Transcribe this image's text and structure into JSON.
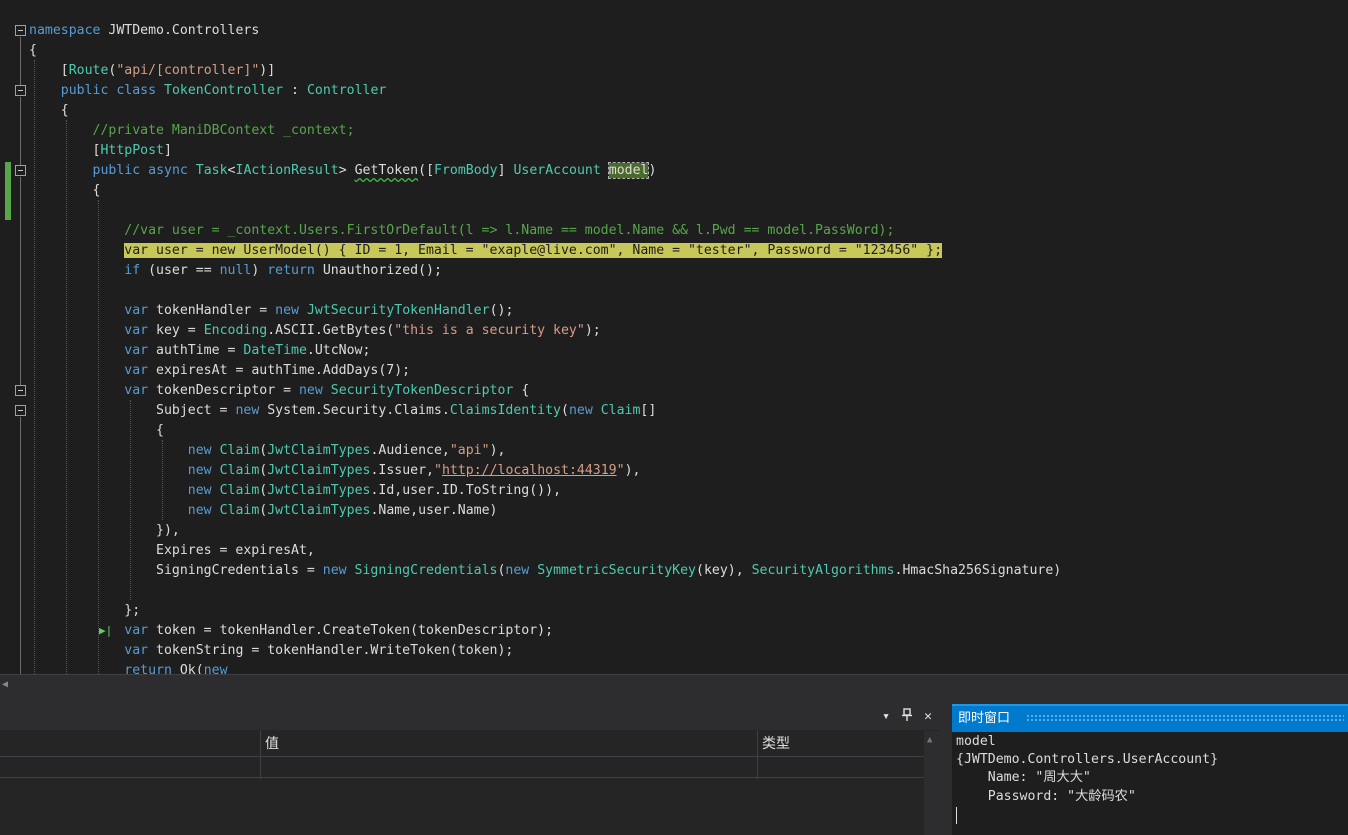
{
  "editor": {
    "lines": [
      [
        [
          "kw",
          "namespace"
        ],
        [
          "p",
          " JWTDemo.Controllers"
        ]
      ],
      [
        [
          "p",
          "{"
        ]
      ],
      [
        [
          "p",
          "    ["
        ],
        [
          "ty",
          "Route"
        ],
        [
          "p",
          "("
        ],
        [
          "st",
          "\"api/[controller]\""
        ],
        [
          "p",
          ")]"
        ]
      ],
      [
        [
          "p",
          "    "
        ],
        [
          "kw",
          "public"
        ],
        [
          "p",
          " "
        ],
        [
          "kw",
          "class"
        ],
        [
          "p",
          " "
        ],
        [
          "ty",
          "TokenController"
        ],
        [
          "p",
          " : "
        ],
        [
          "ty",
          "Controller"
        ]
      ],
      [
        [
          "p",
          "    {"
        ]
      ],
      [
        [
          "p",
          "        "
        ],
        [
          "cm",
          "//private ManiDBContext _context;"
        ]
      ],
      [
        [
          "p",
          "        ["
        ],
        [
          "ty",
          "HttpPost"
        ],
        [
          "p",
          "]"
        ]
      ],
      [
        [
          "p",
          "        "
        ],
        [
          "kw",
          "public"
        ],
        [
          "p",
          " "
        ],
        [
          "kw",
          "async"
        ],
        [
          "p",
          " "
        ],
        [
          "ty",
          "Task"
        ],
        [
          "p",
          "<"
        ],
        [
          "ty",
          "IActionResult"
        ],
        [
          "p",
          "> "
        ],
        [
          "sq",
          "GetToken"
        ],
        [
          "p",
          "(["
        ],
        [
          "ty",
          "FromBody"
        ],
        [
          "p",
          "] "
        ],
        [
          "ty",
          "UserAccount"
        ],
        [
          "p",
          " "
        ],
        [
          "sel",
          "model"
        ],
        [
          "p",
          ")"
        ]
      ],
      [
        [
          "p",
          "        {"
        ]
      ],
      [
        [
          "p",
          ""
        ]
      ],
      [
        [
          "p",
          "            "
        ],
        [
          "cm",
          "//var user = _context.Users.FirstOrDefault(l => l.Name == model.Name && l.Pwd == model.PassWord);"
        ]
      ],
      [
        [
          "p",
          "            "
        ],
        [
          "hl",
          "var user = new UserModel() { ID = 1, Email = \"exaple@live.com\", Name = \"tester\", Password = \"123456\" };"
        ]
      ],
      [
        [
          "p",
          "            "
        ],
        [
          "kw",
          "if"
        ],
        [
          "p",
          " (user == "
        ],
        [
          "kw",
          "null"
        ],
        [
          "p",
          ") "
        ],
        [
          "kw",
          "return"
        ],
        [
          "p",
          " Unauthorized();"
        ]
      ],
      [
        [
          "p",
          ""
        ]
      ],
      [
        [
          "p",
          "            "
        ],
        [
          "kw",
          "var"
        ],
        [
          "p",
          " tokenHandler = "
        ],
        [
          "kw",
          "new"
        ],
        [
          "p",
          " "
        ],
        [
          "ty",
          "JwtSecurityTokenHandler"
        ],
        [
          "p",
          "();"
        ]
      ],
      [
        [
          "p",
          "            "
        ],
        [
          "kw",
          "var"
        ],
        [
          "p",
          " key = "
        ],
        [
          "ty",
          "Encoding"
        ],
        [
          "p",
          ".ASCII.GetBytes("
        ],
        [
          "st",
          "\"this is a security key\""
        ],
        [
          "p",
          ");"
        ]
      ],
      [
        [
          "p",
          "            "
        ],
        [
          "kw",
          "var"
        ],
        [
          "p",
          " authTime = "
        ],
        [
          "ty",
          "DateTime"
        ],
        [
          "p",
          ".UtcNow;"
        ]
      ],
      [
        [
          "p",
          "            "
        ],
        [
          "kw",
          "var"
        ],
        [
          "p",
          " expiresAt = authTime.AddDays(7);"
        ]
      ],
      [
        [
          "p",
          "            "
        ],
        [
          "kw",
          "var"
        ],
        [
          "p",
          " tokenDescriptor = "
        ],
        [
          "kw",
          "new"
        ],
        [
          "p",
          " "
        ],
        [
          "ty",
          "SecurityTokenDescriptor"
        ],
        [
          "p",
          " {"
        ]
      ],
      [
        [
          "p",
          "                Subject = "
        ],
        [
          "kw",
          "new"
        ],
        [
          "p",
          " System.Security.Claims."
        ],
        [
          "ty",
          "ClaimsIdentity"
        ],
        [
          "p",
          "("
        ],
        [
          "kw",
          "new"
        ],
        [
          "p",
          " "
        ],
        [
          "ty",
          "Claim"
        ],
        [
          "p",
          "[]"
        ]
      ],
      [
        [
          "p",
          "                {"
        ]
      ],
      [
        [
          "p",
          "                    "
        ],
        [
          "kw",
          "new"
        ],
        [
          "p",
          " "
        ],
        [
          "ty",
          "Claim"
        ],
        [
          "p",
          "("
        ],
        [
          "ty",
          "JwtClaimTypes"
        ],
        [
          "p",
          ".Audience,"
        ],
        [
          "st",
          "\"api\""
        ],
        [
          "p",
          "),"
        ]
      ],
      [
        [
          "p",
          "                    "
        ],
        [
          "kw",
          "new"
        ],
        [
          "p",
          " "
        ],
        [
          "ty",
          "Claim"
        ],
        [
          "p",
          "("
        ],
        [
          "ty",
          "JwtClaimTypes"
        ],
        [
          "p",
          ".Issuer,"
        ],
        [
          "st",
          "\""
        ],
        [
          "lnk",
          "http://localhost:44319"
        ],
        [
          "st",
          "\""
        ],
        [
          "p",
          "),"
        ]
      ],
      [
        [
          "p",
          "                    "
        ],
        [
          "kw",
          "new"
        ],
        [
          "p",
          " "
        ],
        [
          "ty",
          "Claim"
        ],
        [
          "p",
          "("
        ],
        [
          "ty",
          "JwtClaimTypes"
        ],
        [
          "p",
          ".Id,user.ID.ToString()),"
        ]
      ],
      [
        [
          "p",
          "                    "
        ],
        [
          "kw",
          "new"
        ],
        [
          "p",
          " "
        ],
        [
          "ty",
          "Claim"
        ],
        [
          "p",
          "("
        ],
        [
          "ty",
          "JwtClaimTypes"
        ],
        [
          "p",
          ".Name,user.Name)"
        ]
      ],
      [
        [
          "p",
          "                }),"
        ]
      ],
      [
        [
          "p",
          "                Expires = expiresAt,"
        ]
      ],
      [
        [
          "p",
          "                SigningCredentials = "
        ],
        [
          "kw",
          "new"
        ],
        [
          "p",
          " "
        ],
        [
          "ty",
          "SigningCredentials"
        ],
        [
          "p",
          "("
        ],
        [
          "kw",
          "new"
        ],
        [
          "p",
          " "
        ],
        [
          "ty",
          "SymmetricSecurityKey"
        ],
        [
          "p",
          "(key), "
        ],
        [
          "ty",
          "SecurityAlgorithms"
        ],
        [
          "p",
          ".HmacSha256Signature)"
        ]
      ],
      [
        [
          "p",
          ""
        ]
      ],
      [
        [
          "p",
          "            };"
        ]
      ],
      [
        [
          "p",
          "            "
        ],
        [
          "kw",
          "var"
        ],
        [
          "p",
          " token = tokenHandler.CreateToken(tokenDescriptor);"
        ]
      ],
      [
        [
          "p",
          "            "
        ],
        [
          "kw",
          "var"
        ],
        [
          "p",
          " tokenString = tokenHandler.WriteToken(token);"
        ]
      ],
      [
        [
          "p",
          "            "
        ],
        [
          "kw",
          "return"
        ],
        [
          "p",
          " Ok("
        ],
        [
          "kw",
          "new"
        ]
      ]
    ]
  },
  "locals": {
    "columns": [
      "",
      "值",
      "类型"
    ],
    "icons": {
      "dropdown": "▾",
      "pin": "📌",
      "close": "✕"
    }
  },
  "immediate": {
    "title": "即时窗口",
    "lines": [
      "model",
      "{JWTDemo.Controllers.UserAccount}",
      "    Name: \"周大大\"",
      "    Password: \"大龄码农\""
    ]
  },
  "colors": {
    "background": "#1e1e1e",
    "keyword": "#569cd6",
    "type": "#4ec9b0",
    "string": "#d69d85",
    "comment": "#57a64a",
    "highlight": "#c8c85a",
    "accent": "#007acc"
  }
}
